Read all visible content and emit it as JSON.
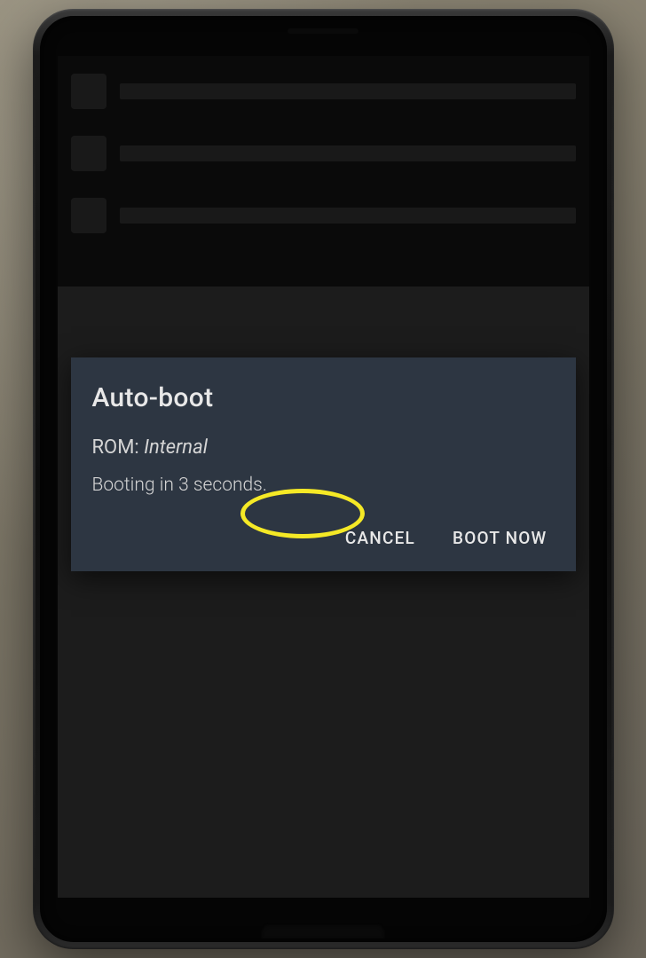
{
  "dialog": {
    "title": "Auto-boot",
    "rom_label": "ROM:",
    "rom_value": "Internal",
    "message": "Booting in 3 seconds.",
    "cancel_button": "CANCEL",
    "boot_button": "BOOT NOW"
  },
  "annotation": {
    "highlighted_button": "cancel"
  }
}
